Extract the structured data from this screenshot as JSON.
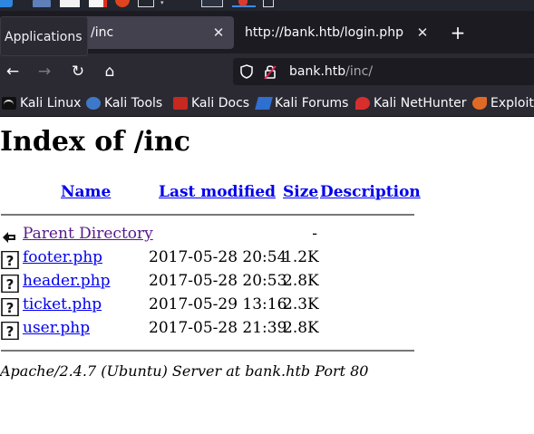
{
  "tooltip": {
    "text": "Applications"
  },
  "tabs": [
    {
      "title": "/inc",
      "active": true,
      "close_glyph": "✕"
    },
    {
      "title": "http://bank.htb/login.php",
      "active": false,
      "close_glyph": "✕"
    }
  ],
  "new_tab_glyph": "+",
  "nav": {
    "back_glyph": "←",
    "forward_glyph": "→",
    "reload_glyph": "↻",
    "home_glyph": "⌂"
  },
  "urlbar": {
    "host": "bank.htb",
    "path": "/inc/"
  },
  "bookmarks": [
    {
      "label": "Kali Linux",
      "icon": "kali-dragon-icon"
    },
    {
      "label": "Kali Tools",
      "icon": "kali-tools-icon"
    },
    {
      "label": "Kali Docs",
      "icon": "kali-docs-icon"
    },
    {
      "label": "Kali Forums",
      "icon": "kali-forums-icon"
    },
    {
      "label": "Kali NetHunter",
      "icon": "kali-nethunter-icon"
    },
    {
      "label": "Exploit-",
      "icon": "exploit-db-icon"
    }
  ],
  "page": {
    "heading": "Index of /inc",
    "columns": {
      "name": "Name",
      "last_modified": "Last modified",
      "size": "Size",
      "description": "Description"
    },
    "parent": {
      "name": "Parent Directory",
      "size": "-"
    },
    "files": [
      {
        "name": "footer.php",
        "modified": "2017-05-28 20:54",
        "size": "1.2K"
      },
      {
        "name": "header.php",
        "modified": "2017-05-28 20:53",
        "size": "2.8K"
      },
      {
        "name": "ticket.php",
        "modified": "2017-05-29 13:16",
        "size": "2.3K"
      },
      {
        "name": "user.php",
        "modified": "2017-05-28 21:39",
        "size": "2.8K"
      }
    ],
    "address": "Apache/2.4.7 (Ubuntu) Server at bank.htb Port 80"
  },
  "colors": {
    "link": "#0000ee",
    "visited": "#551a8b",
    "chrome_dark": "#1c1b22",
    "chrome": "#2b2a33"
  }
}
